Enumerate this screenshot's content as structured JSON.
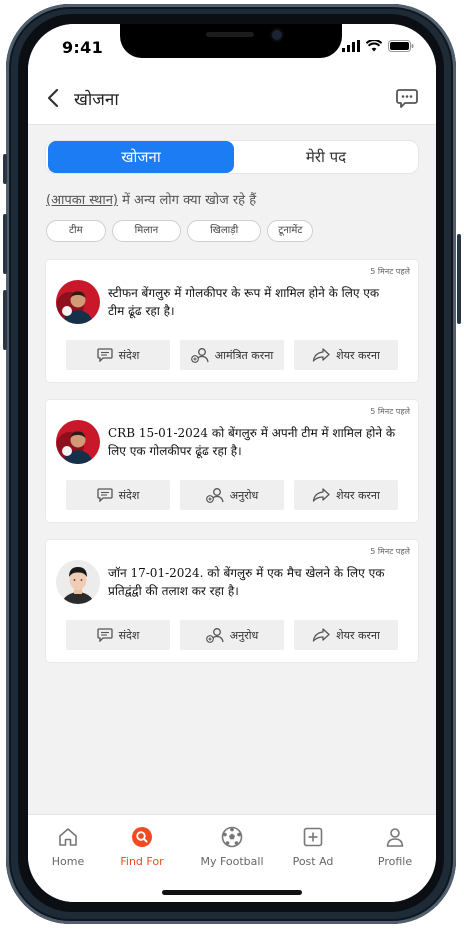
{
  "status_bar": {
    "time": "9:41"
  },
  "header": {
    "title": "खोजना"
  },
  "tabs": [
    {
      "label": "खोजना"
    },
    {
      "label": "मेरी पद"
    }
  ],
  "subline": {
    "location": "(आपका स्थान)",
    "rest": " में अन्य लोग क्या खोज रहे हैं"
  },
  "chips": [
    {
      "label": "टीम"
    },
    {
      "label": "मिलान"
    },
    {
      "label": "खिलाड़ी"
    },
    {
      "label": "टूनामेंट"
    }
  ],
  "posts": [
    {
      "ago": "5 मिनट पहले",
      "text": "स्टीफन बेंगलुरु में गोलकीपर के रूप में शामिल होने के लिए एक टीम ढूंढ रहा है।",
      "actions": [
        "संदेश",
        "आमंत्रित करना",
        "शेयर करना"
      ]
    },
    {
      "ago": "5 मिनट पहले",
      "text": "CRB 15-01-2024 को बेंगलुरु में अपनी टीम में शामिल होने के लिए एक गोलकीपर ढूंढ रहा है।",
      "actions": [
        "संदेश",
        "अनुरोध",
        "शेयर करना"
      ]
    },
    {
      "ago": "5 मिनट पहले",
      "text": "जॉन 17-01-2024. को बेंगलुरु में एक मैच खेलने के लिए एक प्रतिद्वंद्वी की तलाश कर रहा है।",
      "actions": [
        "संदेश",
        "अनुरोध",
        "शेयर करना"
      ]
    }
  ],
  "bottom_nav": [
    {
      "label": "Home",
      "icon": "home-icon"
    },
    {
      "label": "Find For",
      "icon": "search-icon",
      "active": true
    },
    {
      "label": "My Football",
      "icon": "football-icon"
    },
    {
      "label": "Post Ad",
      "icon": "plus-square-icon"
    },
    {
      "label": "Profile",
      "icon": "person-icon"
    }
  ],
  "colors": {
    "accent": "#1b7cf4",
    "nav_active": "#f04a23"
  }
}
